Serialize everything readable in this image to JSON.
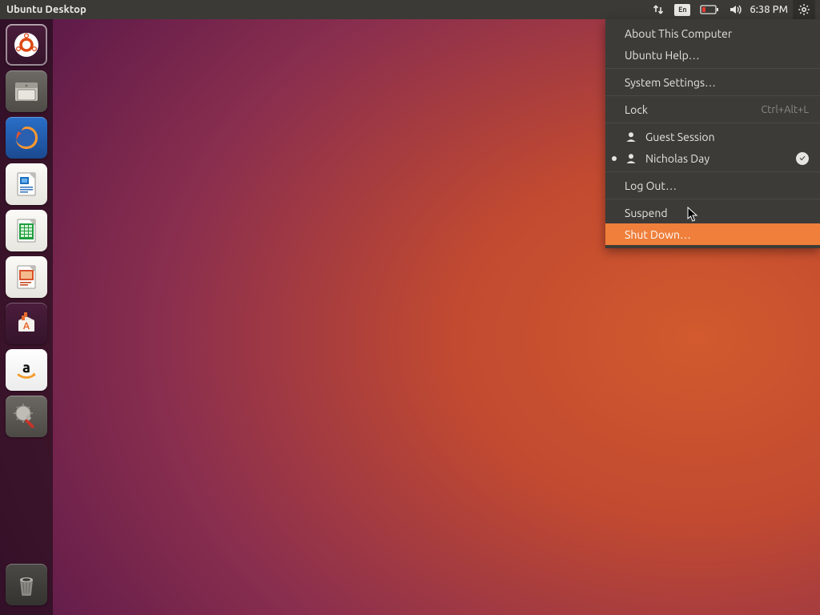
{
  "topbar": {
    "title": "Ubuntu Desktop",
    "time": "6:38 PM",
    "input_method": "En"
  },
  "launcher": {
    "items": [
      {
        "name": "dash",
        "tooltip": "Dash"
      },
      {
        "name": "files",
        "tooltip": "Files"
      },
      {
        "name": "firefox",
        "tooltip": "Firefox Web Browser"
      },
      {
        "name": "writer",
        "tooltip": "LibreOffice Writer"
      },
      {
        "name": "calc",
        "tooltip": "LibreOffice Calc"
      },
      {
        "name": "impress",
        "tooltip": "LibreOffice Impress"
      },
      {
        "name": "software",
        "tooltip": "Ubuntu Software"
      },
      {
        "name": "amazon",
        "tooltip": "Amazon"
      },
      {
        "name": "settings",
        "tooltip": "System Settings"
      }
    ],
    "trash_tooltip": "Trash"
  },
  "menu": {
    "about": "About This Computer",
    "help": "Ubuntu Help…",
    "system_settings": "System Settings…",
    "lock": "Lock",
    "lock_shortcut": "Ctrl+Alt+L",
    "guest_session": "Guest Session",
    "user_name": "Nicholas Day",
    "logout": "Log Out…",
    "suspend": "Suspend",
    "shutdown": "Shut Down…"
  }
}
